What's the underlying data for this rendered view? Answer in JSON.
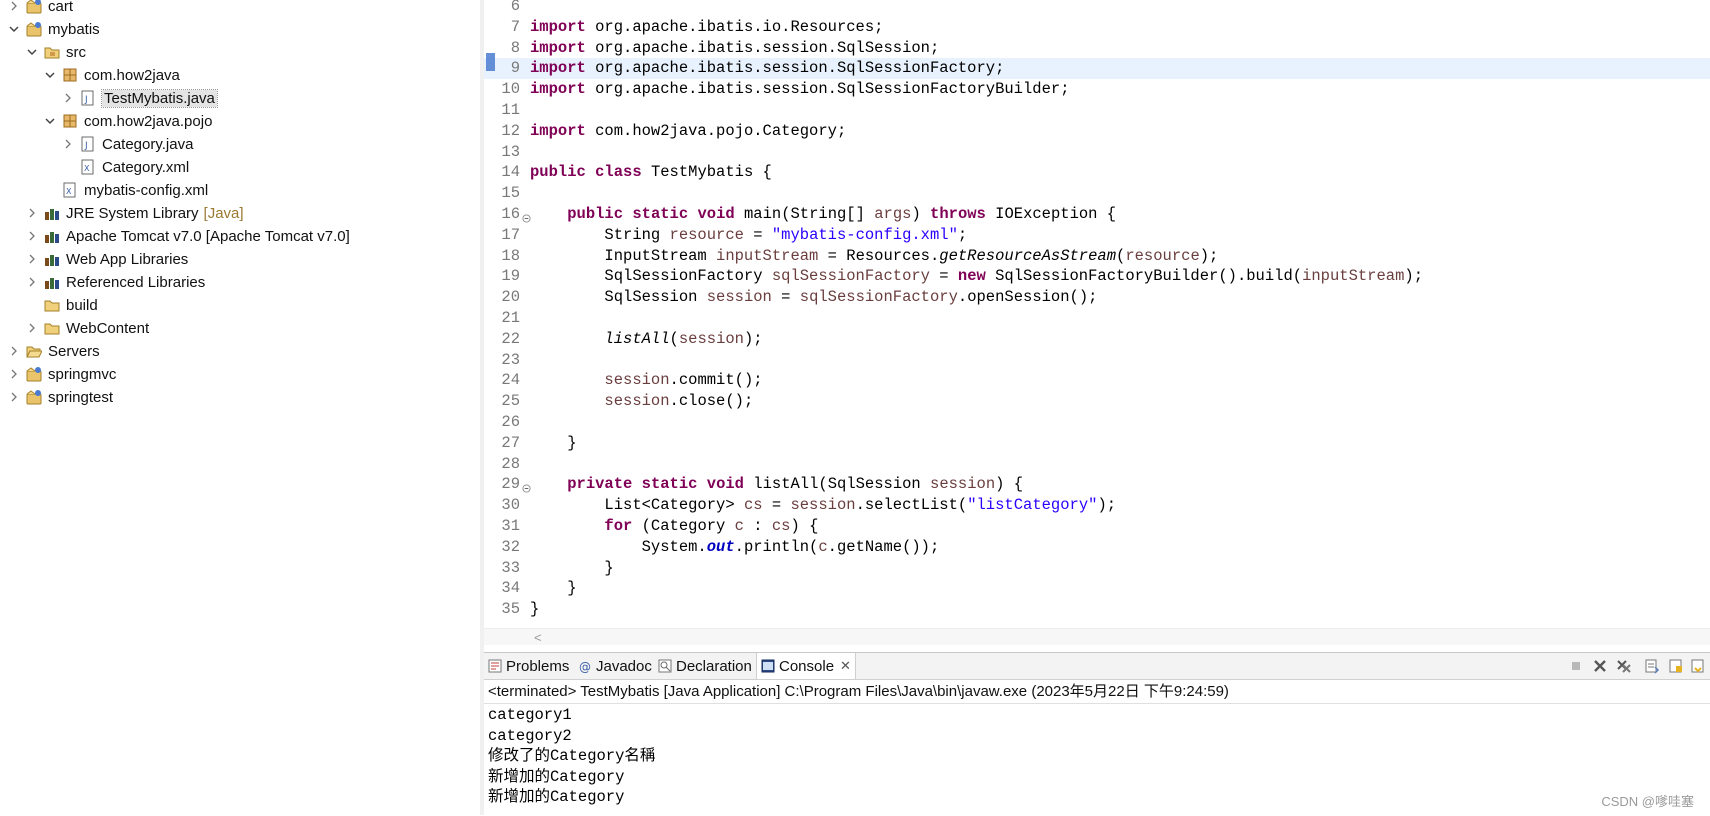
{
  "explorer": {
    "rows": [
      {
        "label": "cart",
        "suffix": "",
        "icon": "project-icon",
        "arrow": "collapsed",
        "selected": false
      },
      {
        "label": "mybatis",
        "suffix": "",
        "icon": "project-icon",
        "arrow": "expanded",
        "selected": false
      },
      {
        "label": "src",
        "suffix": "",
        "icon": "source-folder-icon",
        "arrow": "expanded",
        "selected": false
      },
      {
        "label": "com.how2java",
        "suffix": "",
        "icon": "package-icon",
        "arrow": "expanded",
        "selected": false
      },
      {
        "label": "TestMybatis.java",
        "suffix": "",
        "icon": "java-file-icon",
        "arrow": "collapsed",
        "selected": true
      },
      {
        "label": "com.how2java.pojo",
        "suffix": "",
        "icon": "package-icon",
        "arrow": "expanded",
        "selected": false
      },
      {
        "label": "Category.java",
        "suffix": "",
        "icon": "java-file-icon",
        "arrow": "collapsed",
        "selected": false
      },
      {
        "label": "Category.xml",
        "suffix": "",
        "icon": "xml-file-icon",
        "arrow": "none",
        "selected": false
      },
      {
        "label": "mybatis-config.xml",
        "suffix": "",
        "icon": "xml-file-icon",
        "arrow": "none",
        "selected": false
      },
      {
        "label": "JRE System Library",
        "suffix": "[Java]",
        "icon": "library-icon",
        "arrow": "collapsed",
        "selected": false
      },
      {
        "label": "Apache Tomcat v7.0 [Apache Tomcat v7.0]",
        "suffix": "",
        "icon": "library-icon",
        "arrow": "collapsed",
        "selected": false
      },
      {
        "label": "Web App Libraries",
        "suffix": "",
        "icon": "library-icon",
        "arrow": "collapsed",
        "selected": false
      },
      {
        "label": "Referenced Libraries",
        "suffix": "",
        "icon": "library-icon",
        "arrow": "collapsed",
        "selected": false
      },
      {
        "label": "build",
        "suffix": "",
        "icon": "folder-icon",
        "arrow": "none",
        "selected": false
      },
      {
        "label": "WebContent",
        "suffix": "",
        "icon": "folder-icon",
        "arrow": "collapsed",
        "selected": false
      },
      {
        "label": "Servers",
        "suffix": "",
        "icon": "folder-open-icon",
        "arrow": "collapsed",
        "selected": false
      },
      {
        "label": "springmvc",
        "suffix": "",
        "icon": "project-icon",
        "arrow": "collapsed",
        "selected": false
      },
      {
        "label": "springtest",
        "suffix": "",
        "icon": "project-icon",
        "arrow": "collapsed",
        "selected": false
      }
    ]
  },
  "editor": {
    "current_line": 9,
    "lines": [
      {
        "n": "6",
        "tokens": []
      },
      {
        "n": "7",
        "tokens": [
          [
            "kw",
            "import"
          ],
          [
            "t",
            " org.apache.ibatis.io.Resources;"
          ]
        ]
      },
      {
        "n": "8",
        "tokens": [
          [
            "kw",
            "import"
          ],
          [
            "t",
            " org.apache.ibatis.session.SqlSession;"
          ]
        ]
      },
      {
        "n": "9",
        "tokens": [
          [
            "kw",
            "import"
          ],
          [
            "t",
            " org.apache.ibatis.session.SqlSessionFactory;"
          ]
        ]
      },
      {
        "n": "10",
        "tokens": [
          [
            "kw",
            "import"
          ],
          [
            "t",
            " org.apache.ibatis.session.SqlSessionFactoryBuilder;"
          ]
        ]
      },
      {
        "n": "11",
        "tokens": []
      },
      {
        "n": "12",
        "tokens": [
          [
            "kw",
            "import"
          ],
          [
            "t",
            " com.how2java.pojo.Category;"
          ]
        ]
      },
      {
        "n": "13",
        "tokens": []
      },
      {
        "n": "14",
        "tokens": [
          [
            "kw",
            "public"
          ],
          [
            "t",
            " "
          ],
          [
            "kw",
            "class"
          ],
          [
            "t",
            " TestMybatis {"
          ]
        ]
      },
      {
        "n": "15",
        "tokens": []
      },
      {
        "n": "16",
        "fold": true,
        "tokens": [
          [
            "t",
            "    "
          ],
          [
            "kw",
            "public"
          ],
          [
            "t",
            " "
          ],
          [
            "kw",
            "static"
          ],
          [
            "t",
            " "
          ],
          [
            "kw",
            "void"
          ],
          [
            "t",
            " main(String[] "
          ],
          [
            "var",
            "args"
          ],
          [
            "t",
            ") "
          ],
          [
            "kw",
            "throws"
          ],
          [
            "t",
            " IOException {"
          ]
        ]
      },
      {
        "n": "17",
        "tokens": [
          [
            "t",
            "        String "
          ],
          [
            "var",
            "resource"
          ],
          [
            "t",
            " = "
          ],
          [
            "str",
            "\"mybatis-config.xml\""
          ],
          [
            "t",
            ";"
          ]
        ]
      },
      {
        "n": "18",
        "tokens": [
          [
            "t",
            "        InputStream "
          ],
          [
            "var",
            "inputStream"
          ],
          [
            "t",
            " = Resources."
          ],
          [
            "ital",
            "getResourceAsStream"
          ],
          [
            "t",
            "("
          ],
          [
            "var",
            "resource"
          ],
          [
            "t",
            ");"
          ]
        ]
      },
      {
        "n": "19",
        "tokens": [
          [
            "t",
            "        SqlSessionFactory "
          ],
          [
            "var",
            "sqlSessionFactory"
          ],
          [
            "t",
            " = "
          ],
          [
            "kw",
            "new"
          ],
          [
            "t",
            " SqlSessionFactoryBuilder().build("
          ],
          [
            "var",
            "inputStream"
          ],
          [
            "t",
            ");"
          ]
        ]
      },
      {
        "n": "20",
        "tokens": [
          [
            "t",
            "        SqlSession "
          ],
          [
            "var",
            "session"
          ],
          [
            "t",
            " = "
          ],
          [
            "var",
            "sqlSessionFactory"
          ],
          [
            "t",
            ".openSession();"
          ]
        ]
      },
      {
        "n": "21",
        "tokens": []
      },
      {
        "n": "22",
        "tokens": [
          [
            "t",
            "        "
          ],
          [
            "ital",
            "listAll"
          ],
          [
            "t",
            "("
          ],
          [
            "var",
            "session"
          ],
          [
            "t",
            ");"
          ]
        ]
      },
      {
        "n": "23",
        "tokens": []
      },
      {
        "n": "24",
        "tokens": [
          [
            "t",
            "        "
          ],
          [
            "var",
            "session"
          ],
          [
            "t",
            ".commit();"
          ]
        ]
      },
      {
        "n": "25",
        "tokens": [
          [
            "t",
            "        "
          ],
          [
            "var",
            "session"
          ],
          [
            "t",
            ".close();"
          ]
        ]
      },
      {
        "n": "26",
        "tokens": []
      },
      {
        "n": "27",
        "tokens": [
          [
            "t",
            "    }"
          ]
        ]
      },
      {
        "n": "28",
        "tokens": []
      },
      {
        "n": "29",
        "fold": true,
        "tokens": [
          [
            "t",
            "    "
          ],
          [
            "kw",
            "private"
          ],
          [
            "t",
            " "
          ],
          [
            "kw",
            "static"
          ],
          [
            "t",
            " "
          ],
          [
            "kw",
            "void"
          ],
          [
            "t",
            " listAll(SqlSession "
          ],
          [
            "var",
            "session"
          ],
          [
            "t",
            ") {"
          ]
        ]
      },
      {
        "n": "30",
        "tokens": [
          [
            "t",
            "        List<Category> "
          ],
          [
            "var",
            "cs"
          ],
          [
            "t",
            " = "
          ],
          [
            "var",
            "session"
          ],
          [
            "t",
            ".selectList("
          ],
          [
            "str",
            "\"listCategory\""
          ],
          [
            "t",
            ");"
          ]
        ]
      },
      {
        "n": "31",
        "tokens": [
          [
            "t",
            "        "
          ],
          [
            "kw",
            "for"
          ],
          [
            "t",
            " (Category "
          ],
          [
            "var",
            "c"
          ],
          [
            "t",
            " : "
          ],
          [
            "var",
            "cs"
          ],
          [
            "t",
            ") {"
          ]
        ]
      },
      {
        "n": "32",
        "tokens": [
          [
            "t",
            "            System."
          ],
          [
            "fld",
            "out"
          ],
          [
            "t",
            ".println("
          ],
          [
            "var",
            "c"
          ],
          [
            "t",
            ".getName());"
          ]
        ]
      },
      {
        "n": "33",
        "tokens": [
          [
            "t",
            "        }"
          ]
        ]
      },
      {
        "n": "34",
        "tokens": [
          [
            "t",
            "    }"
          ]
        ]
      },
      {
        "n": "35",
        "tokens": [
          [
            "t",
            "}"
          ]
        ]
      }
    ],
    "scroll_left_glyph": "<"
  },
  "panel": {
    "tabs": [
      {
        "label": "Problems",
        "icon": "problems-icon",
        "active": false
      },
      {
        "label": "Javadoc",
        "icon": "javadoc-icon",
        "active": false
      },
      {
        "label": "Declaration",
        "icon": "declaration-icon",
        "active": false
      },
      {
        "label": "Console",
        "icon": "console-icon",
        "active": true,
        "close": "✕"
      }
    ],
    "console_status": "<terminated> TestMybatis [Java Application] C:\\Program Files\\Java\\bin\\javaw.exe (2023年5月22日 下午9:24:59)",
    "output": [
      "category1",
      "category2",
      "修改了的Category名稱",
      "新增加的Category",
      "新增加的Category"
    ]
  },
  "watermark": "CSDN @嗲哇塞",
  "colors": {
    "keyword": "#7f0055",
    "string": "#2a00ff",
    "variable": "#6a3e3e",
    "current_line": "#e8f2fe"
  }
}
